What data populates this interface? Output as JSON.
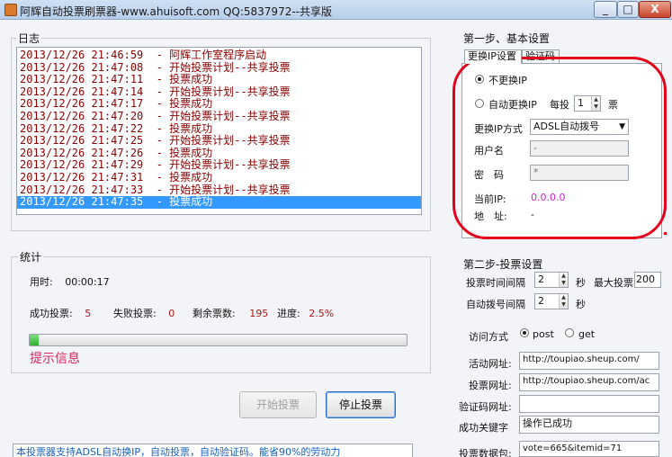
{
  "window": {
    "title": "阿辉自动投票刷票器-www.ahuisoft.com QQ:5837972--共享版",
    "minimize": "_",
    "maximize": "□",
    "close": "X"
  },
  "log": {
    "label": "日志",
    "lines": [
      "2013/12/26 21:46:59  - 阿辉工作室程序启动",
      "2013/12/26 21:47:08  - 开始投票计划--共享投票",
      "2013/12/26 21:47:11  - 投票成功",
      "2013/12/26 21:47:14  - 开始投票计划--共享投票",
      "2013/12/26 21:47:17  - 投票成功",
      "2013/12/26 21:47:20  - 开始投票计划--共享投票",
      "2013/12/26 21:47:22  - 投票成功",
      "2013/12/26 21:47:25  - 开始投票计划--共享投票",
      "2013/12/26 21:47:26  - 投票成功",
      "2013/12/26 21:47:29  - 开始投票计划--共享投票",
      "2013/12/26 21:47:31  - 投票成功",
      "2013/12/26 21:47:33  - 开始投票计划--共享投票",
      "2013/12/26 21:47:35  - 投票成功"
    ],
    "selected_index": 12
  },
  "stats": {
    "label": "统计",
    "time_label": "用时:",
    "time_value": "00:00:17",
    "success_label": "成功投票:",
    "success_value": "5",
    "fail_label": "失败投票:",
    "fail_value": "0",
    "remaining_label": "剩余票数:",
    "remaining_value": "195",
    "progress_label": "进度:",
    "progress_value": "2.5%",
    "progress_fraction": 0.025,
    "hint": "提示信息"
  },
  "buttons": {
    "start": "开始投票",
    "stop": "停止投票"
  },
  "bottom_note": "本投票器支持ADSL自动换IP，自动投票，自动验证码。能省90%的劳动力",
  "step1": {
    "label": "第一步、基本设置",
    "tabs": [
      "更换IP设置",
      "验证码"
    ],
    "no_change_ip": "不更换IP",
    "auto_change_ip": "自动更换IP",
    "per_vote_label": "每投",
    "per_vote_value": "1",
    "vote_unit": "票",
    "method_label": "更换IP方式",
    "method_value": "ADSL自动拨号",
    "username_label": "用户名",
    "username_value": "-",
    "password_label": "密　码",
    "password_value": "*",
    "current_ip_label": "当前IP:",
    "current_ip_value": "0.0.0.0",
    "address_label": "地　址:",
    "address_value": "-"
  },
  "step2": {
    "label": "第二步-投票设置",
    "interval_label": "投票时间间隔",
    "interval_value": "2",
    "interval_unit": "秒",
    "max_label": "最大投票",
    "max_value": "200",
    "dial_label": "自动拨号间隔",
    "dial_value": "2",
    "dial_unit": "秒",
    "access_label": "访问方式",
    "post_label": "post",
    "get_label": "get",
    "activity_url_label": "活动网址:",
    "activity_url_value": "http://toupiao.sheup.com/",
    "vote_url_label": "投票网址:",
    "vote_url_value": "http://toupiao.sheup.com/ac",
    "captcha_url_label": "验证码网址:",
    "captcha_url_value": "",
    "success_key_label": "成功关键字",
    "success_key_value": "操作已成功",
    "vote_data_label": "投票数据包:",
    "vote_data_value": "vote=665&itemid=71"
  },
  "colors": {
    "log_text": "#8b0000",
    "selection": "#3399ff",
    "value_red": "#b01515",
    "hint_pink": "#d8285e",
    "ip_magenta": "#d020d0",
    "annotation_red": "#e3001b"
  }
}
